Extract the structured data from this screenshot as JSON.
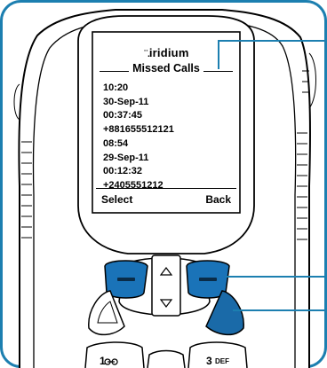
{
  "phone": {
    "brand": "iridium",
    "screen_title": "Missed Calls",
    "entries": [
      "10:20",
      "30-Sep-11",
      "00:37:45",
      "+881655512121",
      "08:54",
      "29-Sep-11",
      "00:12:32",
      "+2405551212"
    ],
    "softkeys": {
      "left": "Select",
      "right": "Back"
    },
    "keypad": {
      "key1": "1",
      "key3": "3",
      "key3_letters": "DEF"
    }
  },
  "colors": {
    "frame_border": "#1c7fb0",
    "phone_outline": "#000000",
    "softkey_blue": "#1a73b8",
    "call_key_blue": "#1a6aa8",
    "callout_blue": "#1c7fb0"
  },
  "icons": [
    "brand-dots-icon",
    "up-arrow-icon",
    "down-arrow-icon",
    "softkey-left-icon",
    "softkey-right-icon",
    "send-key-icon",
    "end-key-icon"
  ]
}
